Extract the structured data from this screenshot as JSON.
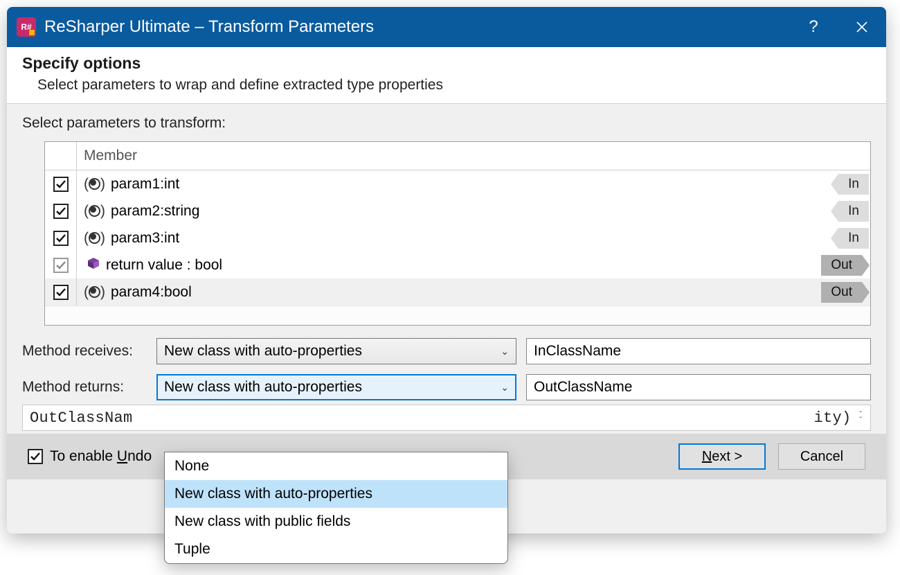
{
  "window": {
    "title": "ReSharper Ultimate – Transform Parameters"
  },
  "header": {
    "title": "Specify options",
    "subtitle": "Select parameters to wrap and define extracted type properties"
  },
  "section": {
    "label": "Select parameters to transform:",
    "columnHeader": "Member"
  },
  "rows": [
    {
      "checked": true,
      "disabled": false,
      "iconType": "param",
      "label": "param1:int",
      "dir": "In"
    },
    {
      "checked": true,
      "disabled": false,
      "iconType": "param",
      "label": "param2:string",
      "dir": "In"
    },
    {
      "checked": true,
      "disabled": false,
      "iconType": "param",
      "label": "param3:int",
      "dir": "In"
    },
    {
      "checked": true,
      "disabled": true,
      "iconType": "cube",
      "label": "return value : bool",
      "dir": "Out"
    },
    {
      "checked": true,
      "disabled": false,
      "iconType": "param",
      "label": "param4:bool",
      "dir": "Out",
      "selected": true
    }
  ],
  "form": {
    "receivesLabel": "Method receives:",
    "receivesValue": "New class with auto-properties",
    "receivesTextbox": "InClassName",
    "returnsLabel": "Method returns:",
    "returnsValue": "New class with auto-properties",
    "returnsTextbox": "OutClassName",
    "returnsOptions": [
      "None",
      "New class with auto-properties",
      "New class with public fields",
      "Tuple"
    ],
    "returnsHighlightedIndex": 1
  },
  "code": {
    "left": "OutClassNam",
    "right": "ity)"
  },
  "footer": {
    "undoLabel": "To enable Undo",
    "next": "Next >",
    "cancel": "Cancel"
  }
}
